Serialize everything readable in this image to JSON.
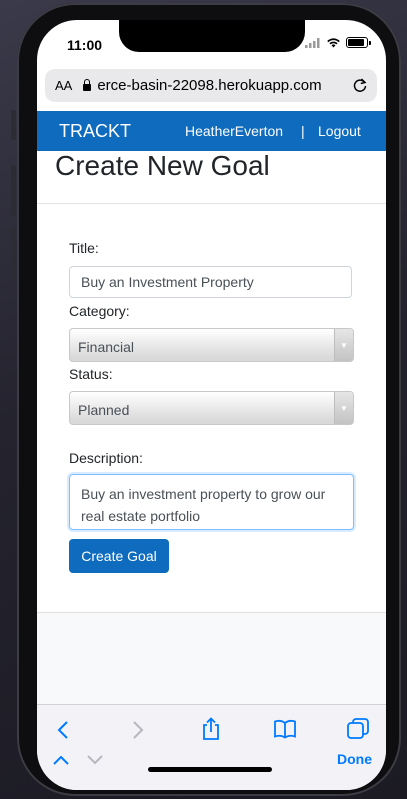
{
  "status_bar": {
    "time": "11:00"
  },
  "browser": {
    "text_size_label": "AA",
    "url": "erce-basin-22098.herokuapp.com",
    "done_label": "Done"
  },
  "navbar": {
    "brand": "TRACKT",
    "user": "HeatherEverton",
    "separator": "|",
    "logout": "Logout"
  },
  "page": {
    "title": "Create New Goal"
  },
  "form": {
    "title_label": "Title:",
    "title_value": "Buy an Investment Property",
    "category_label": "Category:",
    "category_value": "Financial",
    "status_label": "Status:",
    "status_value": "Planned",
    "description_label": "Description:",
    "description_value": "Buy an investment property to grow our real estate portfolio",
    "submit_label": "Create Goal"
  },
  "colors": {
    "brand_blue": "#0e6bbe",
    "ios_blue": "#007aff"
  }
}
